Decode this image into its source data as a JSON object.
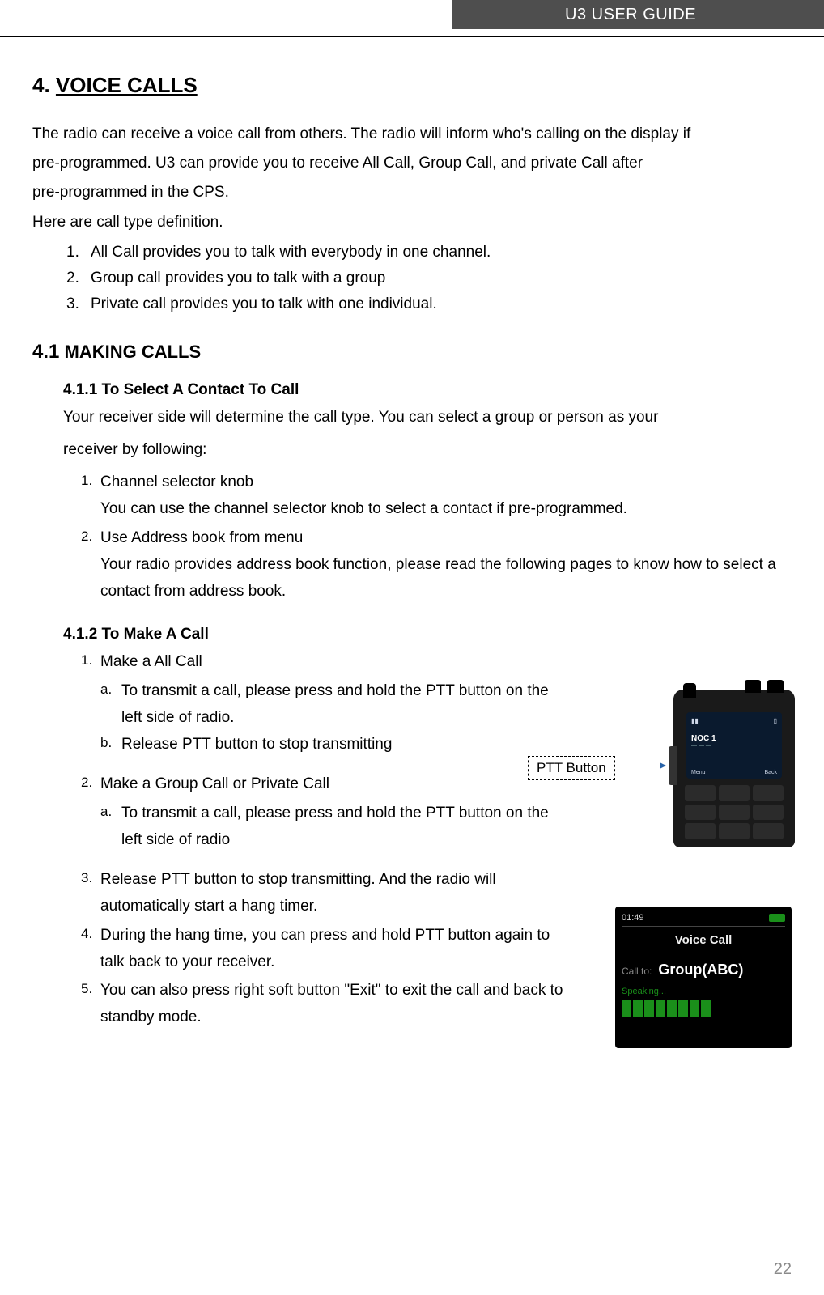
{
  "header": {
    "title": "U3 USER GUIDE"
  },
  "page_number": "22",
  "voice_calls": {
    "num": "4.",
    "title": "VOICE CALLS",
    "intro_l1": "The radio can receive a voice call from others. The radio will inform who's calling on the display if",
    "intro_l2": "pre-programmed. U3 can provide you to receive All Call, Group Call, and private Call after",
    "intro_l3": "pre-programmed in the CPS.",
    "def_intro": "Here are call type definition.",
    "defs": [
      {
        "n": "1.",
        "t": "All Call provides you to talk with everybody in one channel."
      },
      {
        "n": "2.",
        "t": "Group call provides you to talk with a group"
      },
      {
        "n": "3.",
        "t": "Private call provides you to talk with one individual."
      }
    ]
  },
  "making_calls": {
    "prefix": "4.1",
    "title": "MAKING CALLS",
    "s411": {
      "title": "4.1.1 To Select A Contact To Call",
      "intro_l1": "Your receiver side will determine the call type. You can select a group or person as your",
      "intro_l2": "receiver by following:",
      "items": [
        {
          "n": "1.",
          "t": "Channel selector knob",
          "d": "You can use the channel selector knob to select a contact if pre-programmed."
        },
        {
          "n": "2.",
          "t": "Use Address book from menu",
          "d": "Your radio provides address book function, please read the following pages to know how to select a contact from address book."
        }
      ]
    },
    "s412": {
      "title": "4.1.2 To Make A Call",
      "i1": {
        "n": "1.",
        "t": "Make a All Call",
        "sub": [
          {
            "l": "a.",
            "t": "To transmit a call, please press and hold the PTT button on the left side of radio."
          },
          {
            "l": "b.",
            "t": "Release PTT button to stop transmitting"
          }
        ]
      },
      "i2": {
        "n": "2.",
        "t": "Make a Group Call or Private Call",
        "sub": [
          {
            "l": "a.",
            "t": "To transmit a call, please press and hold the PTT button on the left side of radio"
          }
        ]
      },
      "i3": {
        "n": "3.",
        "t": "Release PTT button to stop transmitting. And the radio will automatically start a hang timer."
      },
      "i4": {
        "n": "4.",
        "t": "During the hang time, you can press and hold PTT button again to talk back to your receiver."
      },
      "i5": {
        "n": "5.",
        "t": "You can also press right soft button \"Exit\" to exit the call and back to standby mode."
      }
    }
  },
  "figure_radio": {
    "ptt_label": "PTT Button",
    "screen_main": "NOC 1"
  },
  "figure_screen": {
    "time": "01:49",
    "title": "Voice Call",
    "call_to_label": "Call to:",
    "group": "Group(ABC)",
    "speaking": "Speaking..."
  }
}
